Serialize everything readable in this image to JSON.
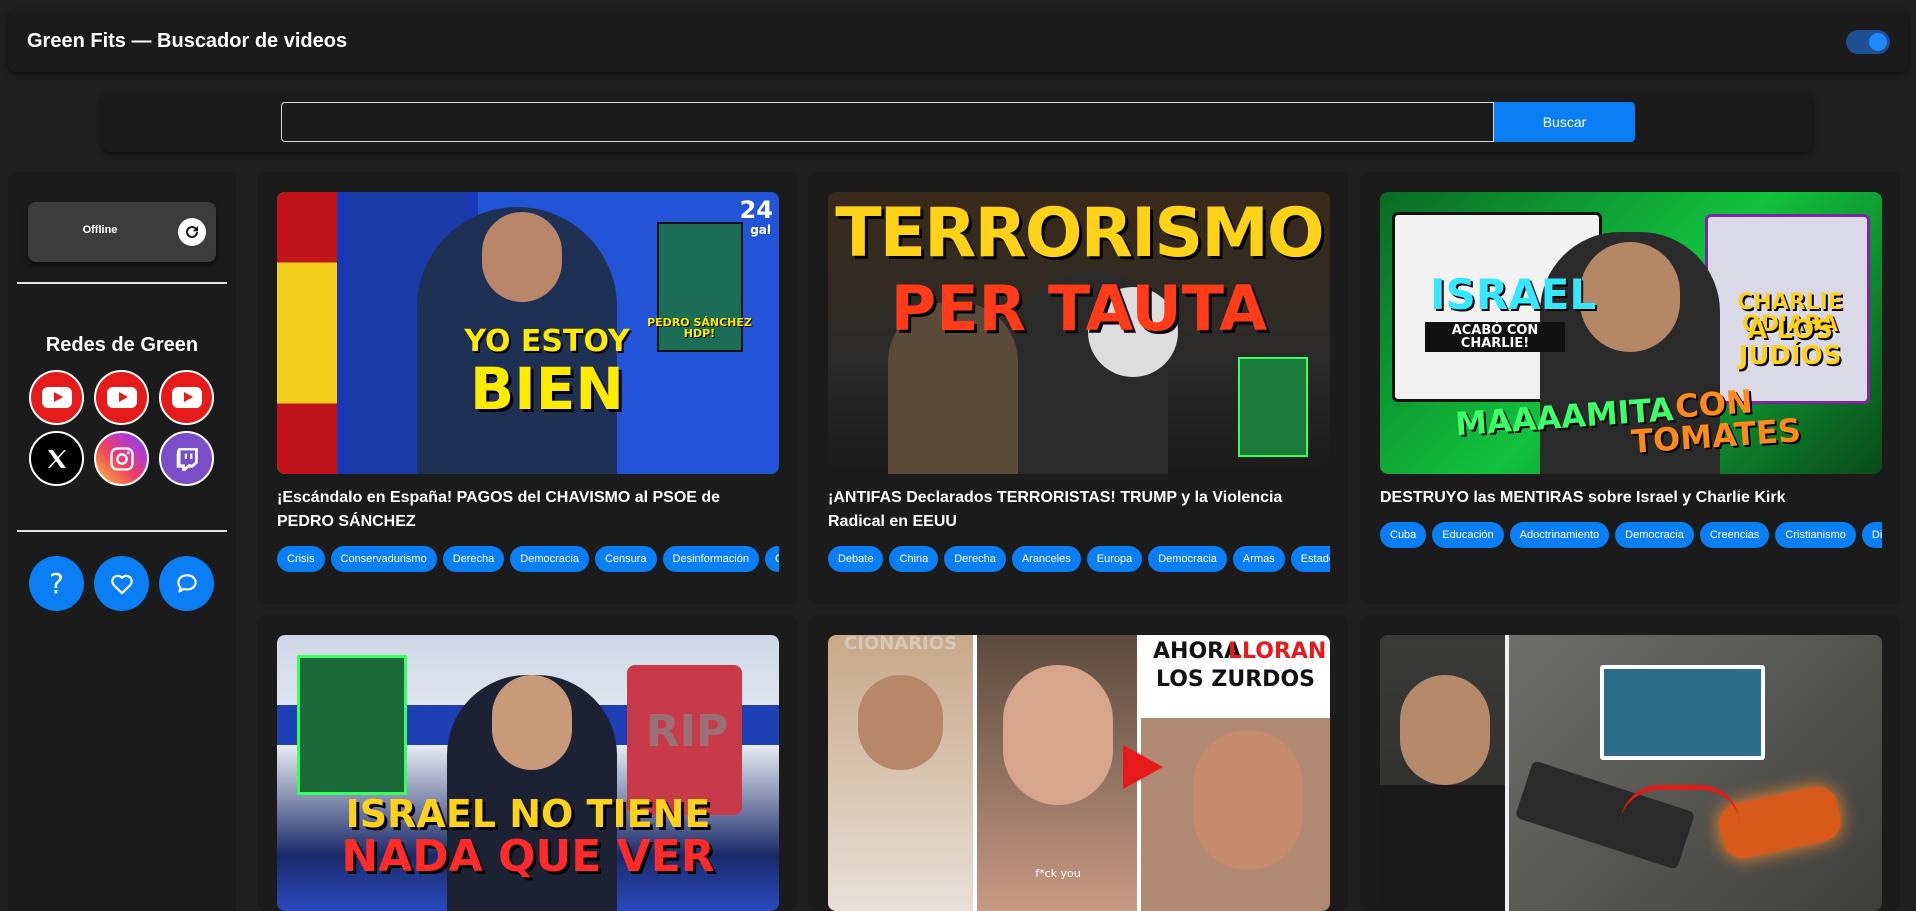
{
  "header": {
    "title": "Green Fits — Buscador de videos"
  },
  "search": {
    "placeholder": "",
    "button_label": "Buscar"
  },
  "sidebar": {
    "status": "Offline",
    "social_title": "Redes de Green"
  },
  "videos": [
    {
      "title": "¡Escándalo en España! PAGOS del CHAVISMO al PSOE de PEDRO SÁNCHEZ",
      "tags": [
        "Crisis",
        "Conservadurismo",
        "Derecha",
        "Democracia",
        "Censura",
        "Desinformación",
        "C"
      ],
      "thumb": {
        "line1": "YO ESTOY",
        "line2": "BIEN",
        "side": "PEDRO SÁNCHEZ HDP!",
        "badge": "24",
        "badge_sub": "gal"
      }
    },
    {
      "title": "¡ANTIFAS Declarados TERRORISTAS! TRUMP y la Violencia Radical en EEUU",
      "tags": [
        "Debate",
        "China",
        "Derecha",
        "Aranceles",
        "Europa",
        "Democracia",
        "Armas",
        "Estados"
      ],
      "thumb": {
        "line1": "TERRORISMO",
        "line2": "PER    TAUTA"
      }
    },
    {
      "title": "DESTRUYO las MENTIRAS sobre Israel y Charlie Kirk",
      "tags": [
        "Cuba",
        "Educación",
        "Adoctrinamiento",
        "Democracia",
        "Creencias",
        "Cristianismo",
        "Div"
      ],
      "thumb": {
        "line1": "ISRAEL",
        "line1_sub": "ACABÓ CON CHARLIE!",
        "line2": "CHARLIE ODIABA",
        "line2b": "A LOS JUDÍOS",
        "line3a": "MAAAAMITA",
        "line3b": "CON TOMATES"
      }
    },
    {
      "title": "",
      "tags": [],
      "thumb": {
        "line1": "ISRAEL NO TIENE",
        "line2": "NADA QUE VER",
        "badge": "RIP"
      }
    },
    {
      "title": "",
      "tags": [],
      "thumb": {
        "line1a": "AHORA",
        "line1b": "LLORAN",
        "line2": "LOS ZURDOS",
        "caption": "f*ck you",
        "top": "CIONARIOS"
      }
    },
    {
      "title": "",
      "tags": [],
      "thumb": {}
    }
  ],
  "colors": {
    "accent": "#0a7ef5",
    "youtube": "#e51b1b",
    "twitch": "#7a4ec9"
  },
  "icons": [
    "youtube-icon",
    "youtube-icon",
    "youtube-icon",
    "x-icon",
    "instagram-icon",
    "twitch-icon",
    "question-icon",
    "heart-icon",
    "chat-icon",
    "refresh-icon"
  ]
}
